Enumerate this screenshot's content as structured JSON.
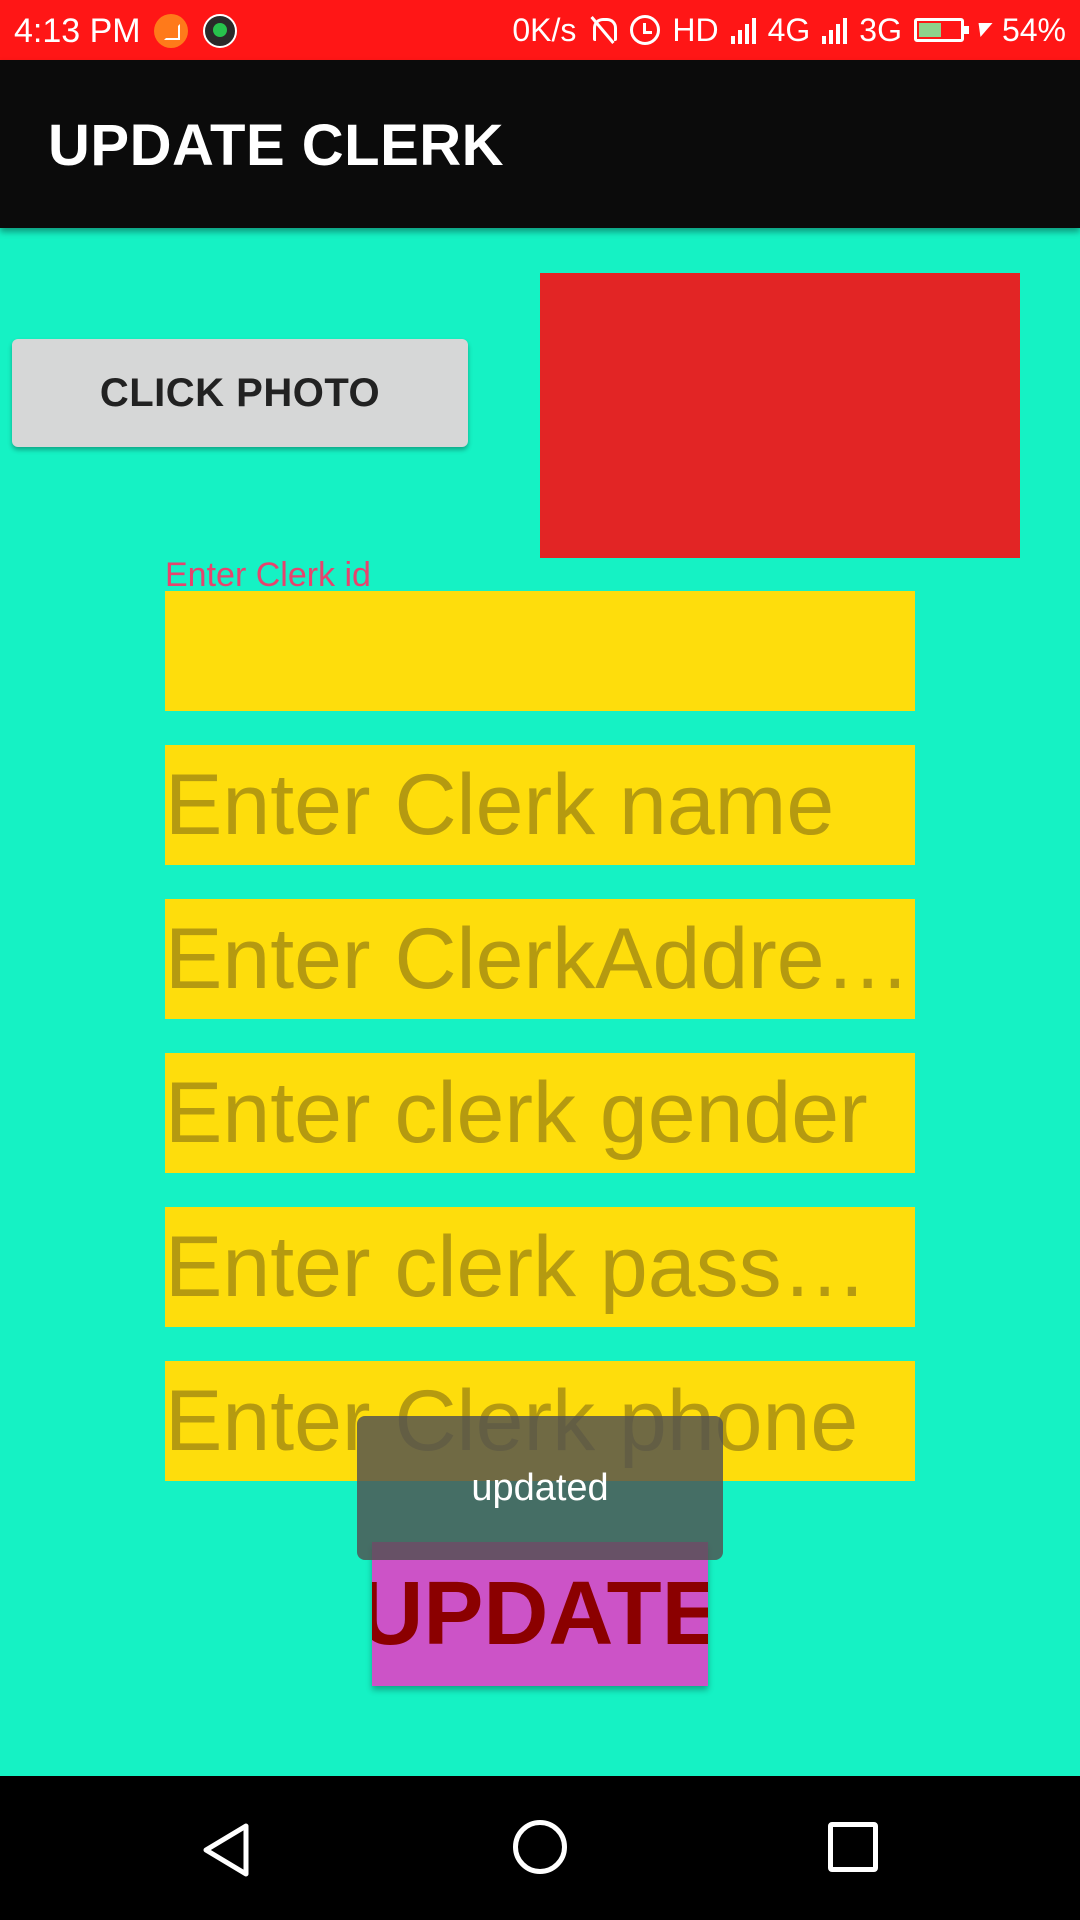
{
  "status_bar": {
    "time": "4:13 PM",
    "net_speed": "0K/s",
    "hd": "HD",
    "network_4g": "4G",
    "network_3g": "3G",
    "battery_percent": "54%",
    "battery_level": 0.54,
    "icons": [
      "crop-notification-icon",
      "call-recorder-icon",
      "bell-off-icon",
      "alarm-icon",
      "signal-icon",
      "battery-icon",
      "charging-icon"
    ]
  },
  "app_bar": {
    "title": "UPDATE CLERK"
  },
  "form": {
    "click_photo_label": "CLICK PHOTO",
    "photo_color": "#e22525",
    "id_label": "Enter Clerk id",
    "id_value": "",
    "name_placeholder": "Enter Clerk name",
    "address_placeholder": "Enter ClerkAddre…",
    "gender_placeholder": "Enter clerk gender",
    "password_placeholder": "Enter clerk pass…",
    "phone_placeholder": "Enter Clerk phone",
    "update_label": "UPDATE"
  },
  "toast": {
    "message": "updated"
  },
  "colors": {
    "background": "#15f2c4",
    "status_bar": "#ff1616",
    "app_bar": "#0b0b0b",
    "field": "#fedd0c",
    "update_button": "#cc53c7",
    "update_text": "#8b0000"
  },
  "nav_bar": {
    "icons": [
      "back-icon",
      "home-icon",
      "recent-apps-icon"
    ]
  }
}
